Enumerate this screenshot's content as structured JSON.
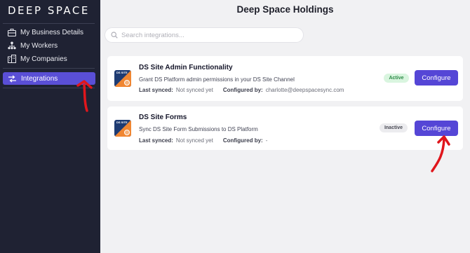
{
  "sidebar": {
    "logo": "DEEP SPACE",
    "items": [
      {
        "label": "My Business Details",
        "icon": "briefcase-icon"
      },
      {
        "label": "My Workers",
        "icon": "org-chart-icon"
      },
      {
        "label": "My Companies",
        "icon": "building-icon"
      }
    ],
    "active_item": {
      "label": "Integrations",
      "icon": "integrations-icon"
    }
  },
  "header": {
    "title": "Deep Space Holdings"
  },
  "search": {
    "placeholder": "Search integrations..."
  },
  "integrations": [
    {
      "title": "DS Site Admin Functionality",
      "description": "Grant DS Platform admin permissions in your DS Site Channel",
      "last_synced_label": "Last synced:",
      "last_synced_value": "Not synced yet",
      "configured_by_label": "Configured by:",
      "configured_by_value": "charlotte@deepspacesync.com",
      "status": "Active",
      "button": "Configure"
    },
    {
      "title": "DS Site Forms",
      "description": "Sync DS Site Form Submissions to DS Platform",
      "last_synced_label": "Last synced:",
      "last_synced_value": "Not synced yet",
      "configured_by_label": "Configured by:",
      "configured_by_value": "-",
      "status": "Inactive",
      "button": "Configure"
    }
  ],
  "thumb_text": "DS SITE",
  "colors": {
    "sidebar_bg": "#1f2233",
    "accent": "#5546d6",
    "active_pill_bg": "#d9f5df",
    "active_pill_text": "#2d8a47",
    "annotation_red": "#e0161c"
  }
}
